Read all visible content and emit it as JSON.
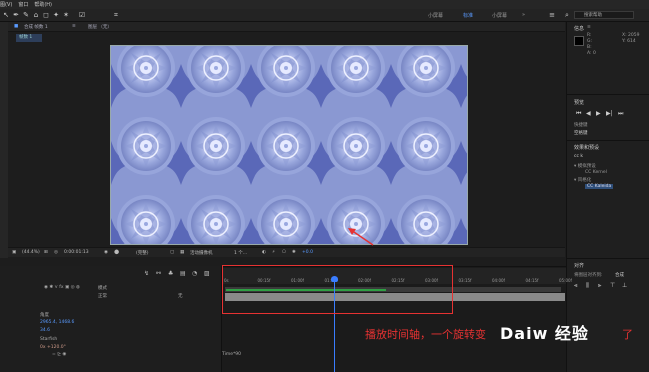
{
  "menubar": [
    "图(V)",
    "窗口",
    "帮助(H)"
  ],
  "toolbar": {
    "workspaces": [
      "小屏幕",
      "标准",
      "小屏幕"
    ],
    "workspace_active_index": 1,
    "search_placeholder": "搜索帮助"
  },
  "comp": {
    "tab_label": "合成 帧数 1",
    "tab2_label": "图层 （无）",
    "subtab": "帧数 1",
    "footer": {
      "zoom": "(44.4%)",
      "timecode": "0:00:01:13",
      "quality": "(完整)",
      "camera": "活动摄像机",
      "views": "1 个...",
      "offset": "+0.0"
    }
  },
  "right": {
    "info_title": "信息",
    "info_lines": [
      "R:",
      "G:",
      "B:",
      "A: 0"
    ],
    "info_coords": [
      "X: 2059",
      "Y: 614"
    ],
    "preview_title": "预览",
    "shortcut_label": "快捷键",
    "shortcut_value": "空格键",
    "effects_title": "效果和预设",
    "effects_search": "cc k",
    "effects_tree": [
      "▾ 模拟预设",
      "CC Kernel",
      "▾ 风格化",
      "CC Kaleida"
    ],
    "effects_selected_index": 3,
    "align_title": "对齐",
    "align_to": "将图层对齐到:",
    "align_target": "合成"
  },
  "timeline": {
    "ticks": [
      "0s",
      "00:15f",
      "01:00f",
      "01:15f",
      "02:00f",
      "02:15f",
      "03:00f",
      "03:15f",
      "04:00f",
      "04:15f",
      "05:00f"
    ],
    "layers": [
      {
        "text": "模式",
        "cls": ""
      },
      {
        "text": "正常",
        "cls": ""
      },
      {
        "text": "无",
        "cls": ""
      }
    ],
    "props": [
      {
        "text": "角度",
        "cls": "layer-blue"
      },
      {
        "text": "2965.4, 1468.6",
        "cls": "layer-blue"
      },
      {
        "text": "34.6",
        "cls": "layer-blue"
      },
      {
        "text": "Starfish",
        "cls": ""
      },
      {
        "text": "0x +120.0°",
        "cls": "layer-orange"
      },
      {
        "text": "Time*90",
        "cls": ""
      }
    ]
  },
  "caption": "播放时间轴，一个旋转变",
  "caption_tail": "了",
  "watermark": "Daiw 经验"
}
